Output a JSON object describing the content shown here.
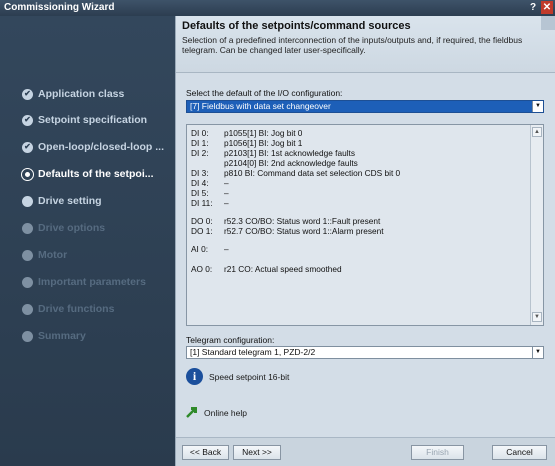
{
  "window": {
    "title": "Commissioning Wizard",
    "help_label": "?",
    "close_label": "✕"
  },
  "steps": [
    {
      "label": "Application class",
      "state": "done"
    },
    {
      "label": "Setpoint specification",
      "state": "done"
    },
    {
      "label": "Open-loop/closed-loop ...",
      "state": "done"
    },
    {
      "label": "Defaults of the setpoi...",
      "state": "active"
    },
    {
      "label": "Drive setting",
      "state": "pending"
    },
    {
      "label": "Drive options",
      "state": "disabled"
    },
    {
      "label": "Motor",
      "state": "disabled"
    },
    {
      "label": "Important parameters",
      "state": "disabled"
    },
    {
      "label": "Drive functions",
      "state": "disabled"
    },
    {
      "label": "Summary",
      "state": "disabled"
    }
  ],
  "header": {
    "title": "Defaults of the setpoints/command sources",
    "description": "Selection of a predefined interconnection of the inputs/outputs and, if required, the fieldbus telegram. Can be changed later user-specifically."
  },
  "io_config": {
    "label": "Select the default of the I/O configuration:",
    "value": "[7] Fieldbus with data set changeover",
    "rows": [
      {
        "key": "DI 0:",
        "value": "p1055[1] BI: Jog bit 0"
      },
      {
        "key": "DI 1:",
        "value": "p1056[1] BI: Jog bit 1"
      },
      {
        "key": "DI 2:",
        "value": "p2103[1] BI: 1st acknowledge faults"
      },
      {
        "key": "",
        "value": "p2104[0] BI: 2nd acknowledge faults"
      },
      {
        "key": "DI 3:",
        "value": "p810 BI: Command data set selection CDS bit 0"
      },
      {
        "key": "DI 4:",
        "value": "–"
      },
      {
        "key": "DI 5:",
        "value": "–"
      },
      {
        "key": "DI 11:",
        "value": "–"
      },
      {
        "key": "DO 0:",
        "value": "r52.3 CO/BO: Status word 1::Fault present"
      },
      {
        "key": "DO 1:",
        "value": "r52.7 CO/BO: Status word 1::Alarm present"
      },
      {
        "key": "AI 0:",
        "value": "–"
      },
      {
        "key": "AO 0:",
        "value": "r21 CO: Actual speed smoothed"
      }
    ]
  },
  "telegram": {
    "label": "Telegram configuration:",
    "value": "[1] Standard telegram 1, PZD-2/2"
  },
  "info": {
    "text": "Speed setpoint 16-bit"
  },
  "help": {
    "text": "Online help"
  },
  "footer": {
    "back_label": "<< Back",
    "next_label": "Next >>",
    "finish_label": "Finish",
    "cancel_label": "Cancel"
  }
}
